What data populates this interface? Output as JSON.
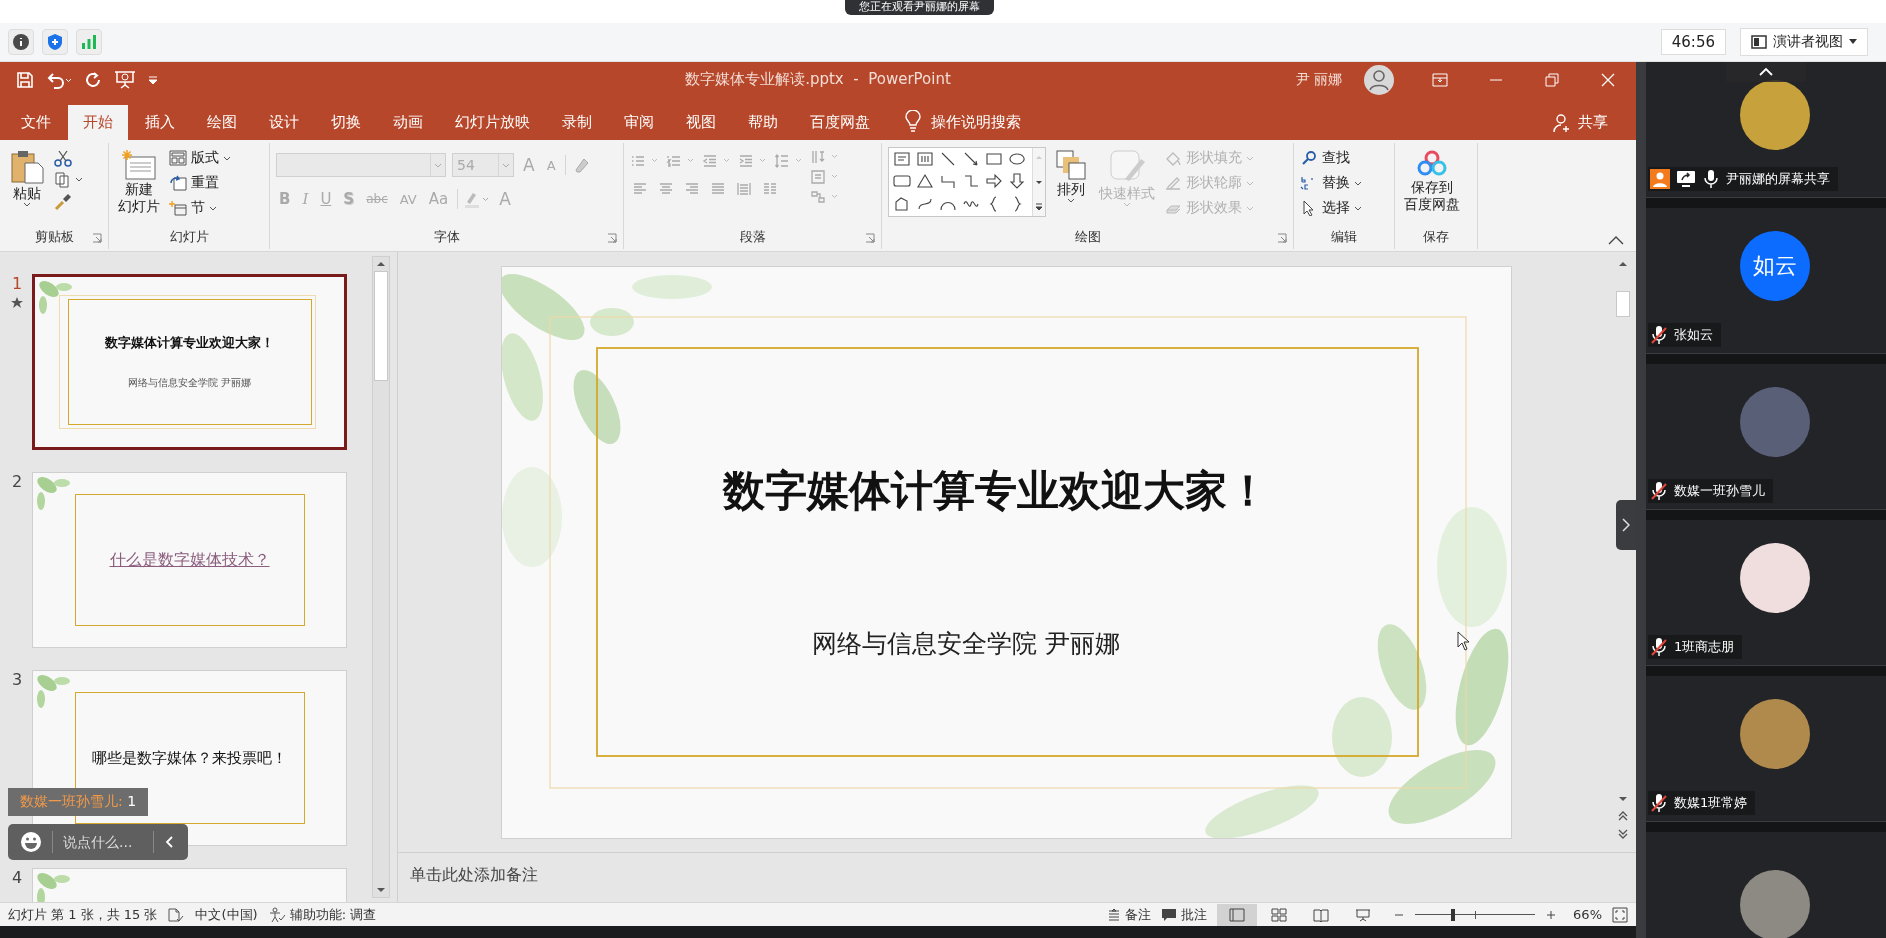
{
  "share_banner": {
    "text": "您正在观看尹丽娜的屏幕"
  },
  "meeting_bar": {
    "time": "46:56",
    "view_menu": "演讲者视图"
  },
  "window": {
    "title": "数字媒体专业解读.pptx  -  PowerPoint",
    "user": "尹 丽娜"
  },
  "tabs": [
    {
      "label": "文件",
      "selected": false
    },
    {
      "label": "开始",
      "selected": true
    },
    {
      "label": "插入",
      "selected": false
    },
    {
      "label": "绘图",
      "selected": false
    },
    {
      "label": "设计",
      "selected": false
    },
    {
      "label": "切换",
      "selected": false
    },
    {
      "label": "动画",
      "selected": false
    },
    {
      "label": "幻灯片放映",
      "selected": false
    },
    {
      "label": "录制",
      "selected": false
    },
    {
      "label": "审阅",
      "selected": false
    },
    {
      "label": "视图",
      "selected": false
    },
    {
      "label": "帮助",
      "selected": false
    },
    {
      "label": "百度网盘",
      "selected": false
    }
  ],
  "tell_me": "操作说明搜索",
  "share": "共享",
  "ribbon": [
    {
      "kind": "clipboard",
      "label": "剪贴板",
      "large": [
        {
          "lines": [
            "粘贴"
          ],
          "disabled": false
        }
      ]
    },
    {
      "kind": "slides",
      "label": "幻灯片",
      "large": [
        {
          "lines": [
            "新建",
            "幻灯片"
          ],
          "disabled": false
        }
      ],
      "small": [
        {
          "label": "版式",
          "disabled": false
        },
        {
          "label": "重置",
          "disabled": false
        },
        {
          "label": "节",
          "disabled": false
        }
      ]
    },
    {
      "kind": "font",
      "label": "字体",
      "font_size": "54",
      "size_buttons": [
        "A",
        "A"
      ],
      "format_buttons": [
        "B",
        "I",
        "U",
        "S",
        "abc",
        "AV",
        "Aa"
      ],
      "color_button": "A"
    },
    {
      "kind": "paragraph",
      "label": "段落"
    },
    {
      "kind": "drawing",
      "label": "绘图",
      "large": [
        {
          "lines": [
            "排列"
          ],
          "disabled": false
        },
        {
          "lines": [
            "快速样式"
          ],
          "disabled": true
        }
      ],
      "small": [
        {
          "label": "形状填充",
          "disabled": true
        },
        {
          "label": "形状轮廓",
          "disabled": true
        },
        {
          "label": "形状效果",
          "disabled": true
        }
      ]
    },
    {
      "kind": "editing",
      "label": "编辑",
      "small": [
        {
          "label": "查找",
          "disabled": false
        },
        {
          "label": "替换",
          "disabled": false
        },
        {
          "label": "选择",
          "disabled": false
        }
      ]
    },
    {
      "kind": "save",
      "label": "保存",
      "large": [
        {
          "lines": [
            "保存到",
            "百度网盘"
          ],
          "disabled": false
        }
      ]
    }
  ],
  "slide_panel": {
    "thumbnails": [
      {
        "number": "1",
        "kind": "title_slide",
        "selected": true,
        "starred": true,
        "title": "数字媒体计算专业欢迎大家！",
        "subtitle": "网络与信息安全学院  尹丽娜"
      },
      {
        "number": "2",
        "kind": "link_slide",
        "selected": false,
        "starred": false,
        "title": "什么是数字媒体技术？"
      },
      {
        "number": "3",
        "kind": "text_slide",
        "selected": false,
        "starred": false,
        "title": "哪些是数字媒体？来投票吧！"
      },
      {
        "number": "4",
        "kind": "cut_slide",
        "selected": false,
        "starred": false
      }
    ]
  },
  "slide": {
    "title": "数字媒体计算专业欢迎大家！",
    "subtitle": "网络与信息安全学院  尹丽娜"
  },
  "notes": {
    "placeholder": "单击此处添加备注"
  },
  "chat": {
    "messages": [
      {
        "sender": "数媒一班孙雪儿:",
        "text": "1"
      }
    ],
    "input": {
      "placeholder": "说点什么..."
    }
  },
  "status_bar": {
    "slide_info": "幻灯片 第 1 张，共 15 张",
    "language": "中文(中国)",
    "accessibility": "辅助功能: 调查",
    "notes": "备注",
    "comments": "批注",
    "views": [
      {
        "kind": "normal",
        "selected": true
      },
      {
        "kind": "sorter",
        "selected": false
      },
      {
        "kind": "reading",
        "selected": false
      },
      {
        "kind": "slideshow",
        "selected": false
      }
    ],
    "zoom": {
      "level": 0.32,
      "reading": "66%"
    }
  },
  "participants": [
    {
      "kind": "sharer",
      "name": "尹丽娜的屏幕共享",
      "muted": false
    },
    {
      "kind": "member",
      "name": "张如云",
      "muted": true,
      "initials": "如云"
    },
    {
      "kind": "member",
      "name": "数媒一班孙雪儿",
      "muted": true
    },
    {
      "kind": "member",
      "name": "1班商志朋",
      "muted": true
    },
    {
      "kind": "member",
      "name": "数媒1班常婷",
      "muted": true
    },
    {
      "kind": "partial"
    }
  ]
}
